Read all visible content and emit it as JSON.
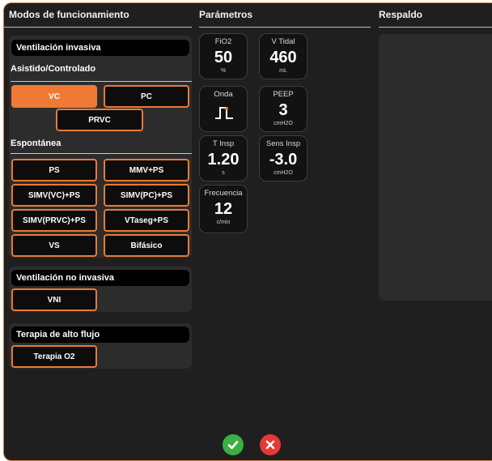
{
  "columns": {
    "modes_title": "Modos de funcionamiento",
    "params_title": "Parámetros",
    "backup_title": "Respaldo"
  },
  "invasive": {
    "title": "Ventilación invasiva",
    "assisted_label": "Asistido/Controlado",
    "assisted_modes": [
      "VC",
      "PC",
      "PRVC"
    ],
    "selected_mode": "VC",
    "spontaneous_label": "Espontánea",
    "spontaneous_modes": [
      "PS",
      "MMV+PS",
      "SIMV(VC)+PS",
      "SIMV(PC)+PS",
      "SIMV(PRVC)+PS",
      "VTaseg+PS",
      "VS",
      "Bifásico"
    ]
  },
  "noninvasive": {
    "title": "Ventilación no invasiva",
    "modes": [
      "VNI"
    ]
  },
  "highflow": {
    "title": "Terapia de alto flujo",
    "modes": [
      "Terapia O2"
    ]
  },
  "params": [
    {
      "label": "FiO2",
      "value": "50",
      "unit": "%"
    },
    {
      "label": "V Tidal",
      "value": "460",
      "unit": "mL"
    },
    {
      "label": "Onda",
      "icon": "square-wave-icon"
    },
    {
      "label": "PEEP",
      "value": "3",
      "unit": "cmH2O"
    },
    {
      "label": "T Insp",
      "value": "1.20",
      "unit": "s"
    },
    {
      "label": "Sens Insp",
      "value": "-3.0",
      "unit": "cmH2O"
    },
    {
      "label": "Frecuencia",
      "value": "12",
      "unit": "c/min"
    }
  ],
  "colors": {
    "accent": "#f07a35",
    "confirm": "#3cb043",
    "cancel": "#e53935"
  },
  "actions": {
    "confirm_icon": "check-circle-icon",
    "cancel_icon": "x-circle-icon"
  }
}
